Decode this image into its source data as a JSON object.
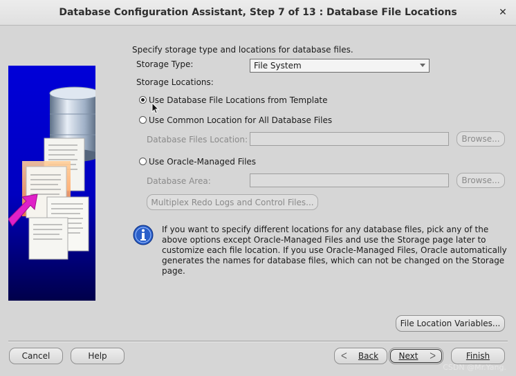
{
  "window": {
    "title": "Database Configuration Assistant, Step 7 of 13 : Database File Locations",
    "close_symbol": "✕"
  },
  "main": {
    "description": "Specify storage type and locations for database files.",
    "storage_type_label": "Storage Type:",
    "storage_type_value": "File System",
    "storage_locations_label": "Storage Locations:",
    "options": [
      {
        "label": "Use Database File Locations from Template",
        "selected": true
      },
      {
        "label": "Use Common Location for All Database Files",
        "selected": false
      },
      {
        "label": "Use Oracle-Managed Files",
        "selected": false
      }
    ],
    "database_files_location_label": "Database Files Location:",
    "database_files_location_value": "",
    "database_area_label": "Database Area:",
    "database_area_value": "",
    "browse_label": "Browse...",
    "multiplex_label": "Multiplex Redo Logs and Control Files...",
    "info_text": "If you want to specify different locations for any database files, pick any of the above options except Oracle-Managed Files and use the Storage page later to customize each file location. If you use Oracle-Managed Files, Oracle automatically generates the names for database files, which can not be changed on the Storage page.",
    "file_location_variables_label": "File Location Variables..."
  },
  "footer": {
    "cancel_label": "Cancel",
    "help_label": "Help",
    "back_label": "Back",
    "next_label": "Next",
    "finish_label": "Finish"
  },
  "watermark": "CSDN @Mr.Yang.",
  "colors": {
    "panel_blue": "#0000cc",
    "arrow_magenta": "#e020c8",
    "info_blue": "#2a5fc9"
  }
}
